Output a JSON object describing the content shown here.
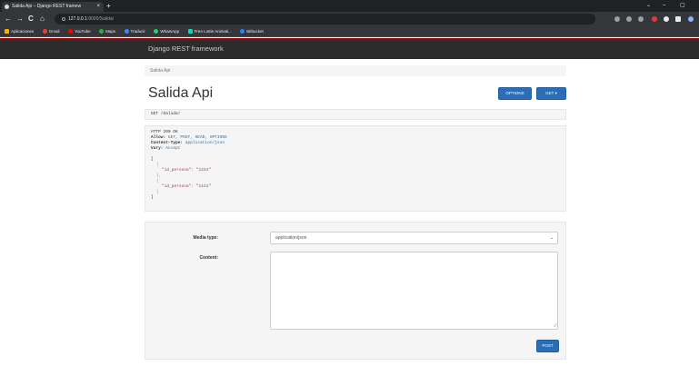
{
  "browser": {
    "tab_title": "Salida Api – Django REST framew",
    "tab_close": "×",
    "new_tab": "+",
    "nav": {
      "back": "←",
      "forward": "→",
      "reload": "C",
      "home": "⌂"
    },
    "url_host": "127.0.0.1",
    "url_path": ":8000/Salida/",
    "window_controls": {
      "minimize": "–",
      "close": "×"
    },
    "bookmarks": [
      {
        "label": "Aplicaciones",
        "color": "#f4b400"
      },
      {
        "label": "Gmail",
        "color": "#ea4335"
      },
      {
        "label": "YouTube",
        "color": "#ff0000"
      },
      {
        "label": "Maps",
        "color": "#34a853"
      },
      {
        "label": "Traducir",
        "color": "#4285f4"
      },
      {
        "label": "WhatsApp",
        "color": "#25d366"
      },
      {
        "label": "Free Lottie Animati...",
        "color": "#00ddb3"
      },
      {
        "label": "Bitbucket",
        "color": "#2684ff"
      }
    ]
  },
  "drf": {
    "brand": "Django REST framework",
    "breadcrumb": "Salida Api",
    "title": "Salida Api",
    "options_label": "OPTIONS",
    "get_label": "GET ▾",
    "request_line": "GET /Salida/",
    "response": {
      "status": "HTTP 200 OK",
      "headers": [
        {
          "name": "Allow:",
          "value": "GET, POST, HEAD, OPTIONS"
        },
        {
          "name": "Content-Type:",
          "value": "application/json"
        },
        {
          "name": "Vary:",
          "value": "Accept"
        }
      ],
      "json": {
        "open_array": "[",
        "open_obj": "{",
        "close_obj_comma": "},",
        "close_obj": "}",
        "close_array": "]",
        "items": [
          {
            "key": "\"id_persona\":",
            "value": "\"1234\""
          },
          {
            "key": "\"id_persona\":",
            "value": "\"1121\""
          }
        ]
      }
    },
    "form": {
      "media_type_label": "Media type:",
      "media_type_value": "application/json",
      "content_label": "Content:",
      "post_label": "POST"
    }
  }
}
